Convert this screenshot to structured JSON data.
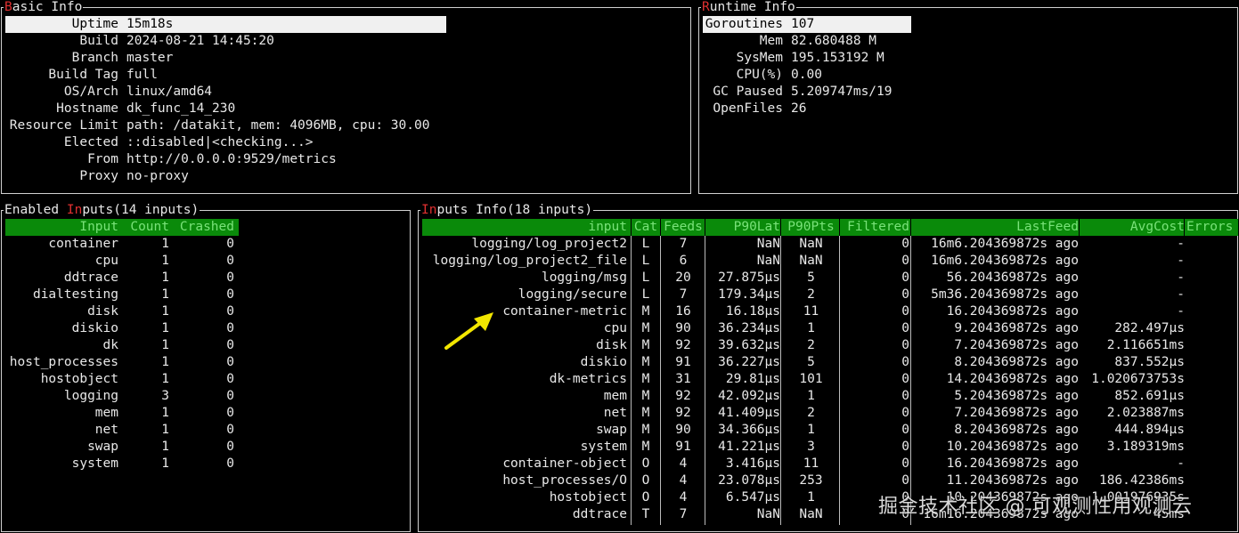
{
  "basic": {
    "title_first": "B",
    "title_rest": "asic Info",
    "rows": [
      {
        "label": "Uptime",
        "value": "15m18s"
      },
      {
        "label": "Build",
        "value": "2024-08-21 14:45:20"
      },
      {
        "label": "Branch",
        "value": "master"
      },
      {
        "label": "Build Tag",
        "value": "full"
      },
      {
        "label": "OS/Arch",
        "value": "linux/amd64"
      },
      {
        "label": "Hostname",
        "value": "dk_func_14_230"
      },
      {
        "label": "Resource Limit",
        "value": "path: /datakit, mem: 4096MB, cpu: 30.00"
      },
      {
        "label": "Elected",
        "value": "::disabled|<checking...>"
      },
      {
        "label": "From",
        "value": "http://0.0.0.0:9529/metrics"
      },
      {
        "label": "Proxy",
        "value": "no-proxy"
      }
    ]
  },
  "runtime": {
    "title_first": "R",
    "title_rest": "untime Info",
    "rows": [
      {
        "label": "Goroutines",
        "value": "107"
      },
      {
        "label": "Mem",
        "value": "82.680488 M"
      },
      {
        "label": "SysMem",
        "value": "195.153192 M"
      },
      {
        "label": "CPU(%)",
        "value": "0.00"
      },
      {
        "label": "GC Paused",
        "value": "5.209747ms/19"
      },
      {
        "label": "OpenFiles",
        "value": "26"
      }
    ]
  },
  "enabled": {
    "title_pre": "Enabled ",
    "title_red": "In",
    "title_post": "puts(14 inputs)",
    "headers": [
      "Input",
      "Count",
      "Crashed"
    ],
    "rows": [
      [
        "container",
        "1",
        "0"
      ],
      [
        "cpu",
        "1",
        "0"
      ],
      [
        "ddtrace",
        "1",
        "0"
      ],
      [
        "dialtesting",
        "1",
        "0"
      ],
      [
        "disk",
        "1",
        "0"
      ],
      [
        "diskio",
        "1",
        "0"
      ],
      [
        "dk",
        "1",
        "0"
      ],
      [
        "host_processes",
        "1",
        "0"
      ],
      [
        "hostobject",
        "1",
        "0"
      ],
      [
        "logging",
        "3",
        "0"
      ],
      [
        "mem",
        "1",
        "0"
      ],
      [
        "net",
        "1",
        "0"
      ],
      [
        "swap",
        "1",
        "0"
      ],
      [
        "system",
        "1",
        "0"
      ]
    ]
  },
  "inputs": {
    "title_red": "In",
    "title_post": "puts Info(18 inputs)",
    "headers": [
      "input",
      "Cat",
      "Feeds",
      "P90Lat",
      "P90Pts",
      "Filtered",
      "LastFeed",
      "AvgCost",
      "Errors"
    ],
    "rows": [
      [
        "logging/log_project2",
        "L",
        "7",
        "NaN",
        "NaN",
        "0",
        "16m6.204369872s ago",
        "-"
      ],
      [
        "logging/log_project2_file",
        "L",
        "6",
        "NaN",
        "NaN",
        "0",
        "16m6.204369872s ago",
        "-"
      ],
      [
        "logging/msg",
        "L",
        "20",
        "27.875µs",
        "5",
        "0",
        "56.204369872s ago",
        "-"
      ],
      [
        "logging/secure",
        "L",
        "7",
        "179.34µs",
        "2",
        "0",
        "5m36.204369872s ago",
        "-"
      ],
      [
        "container-metric",
        "M",
        "16",
        "16.18µs",
        "11",
        "0",
        "16.204369872s ago",
        "-"
      ],
      [
        "cpu",
        "M",
        "90",
        "36.234µs",
        "1",
        "0",
        "9.204369872s ago",
        "282.497µs"
      ],
      [
        "disk",
        "M",
        "92",
        "39.632µs",
        "2",
        "0",
        "7.204369872s ago",
        "2.116651ms"
      ],
      [
        "diskio",
        "M",
        "91",
        "36.227µs",
        "5",
        "0",
        "8.204369872s ago",
        "837.552µs"
      ],
      [
        "dk-metrics",
        "M",
        "31",
        "29.81µs",
        "101",
        "0",
        "14.204369872s ago",
        "1.020673753s"
      ],
      [
        "mem",
        "M",
        "92",
        "42.092µs",
        "1",
        "0",
        "5.204369872s ago",
        "852.691µs"
      ],
      [
        "net",
        "M",
        "92",
        "41.409µs",
        "2",
        "0",
        "7.204369872s ago",
        "2.023887ms"
      ],
      [
        "swap",
        "M",
        "90",
        "34.366µs",
        "1",
        "0",
        "8.204369872s ago",
        "444.894µs"
      ],
      [
        "system",
        "M",
        "91",
        "41.221µs",
        "3",
        "0",
        "10.204369872s ago",
        "3.189319ms"
      ],
      [
        "container-object",
        "O",
        "4",
        "3.416µs",
        "11",
        "0",
        "16.204369872s ago",
        "-"
      ],
      [
        "host_processes/O",
        "O",
        "4",
        "23.078µs",
        "253",
        "0",
        "11.204369872s ago",
        "186.42386ms"
      ],
      [
        "hostobject",
        "O",
        "4",
        "6.547µs",
        "1",
        "0",
        "10.204369872s ago",
        "1.001976935s"
      ],
      [
        "ddtrace",
        "T",
        "7",
        "NaN",
        "NaN",
        "0",
        "16m16.204369872s ago",
        "45ms"
      ]
    ]
  },
  "watermark": "掘金技术社区 @ 可观测性用观测云",
  "colors": {
    "header_bg": "#0a8a0a",
    "header_fg": "#79e279",
    "highlight_bg": "#f0f0f0",
    "accent_red": "#e03030",
    "arrow": "#f2e600"
  }
}
